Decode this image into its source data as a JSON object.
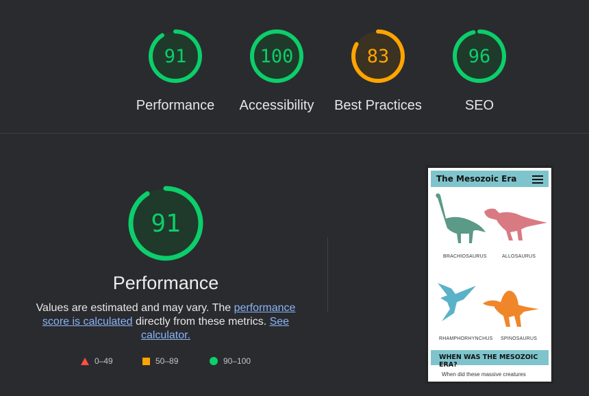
{
  "scores": [
    {
      "label": "Performance",
      "value": "91",
      "fraction": 0.91,
      "color": "#0cce6b",
      "fill": "#1f3a2a"
    },
    {
      "label": "Accessibility",
      "value": "100",
      "fraction": 1.0,
      "color": "#0cce6b",
      "fill": "#1f3a2a"
    },
    {
      "label": "Best Practices",
      "value": "83",
      "fraction": 0.83,
      "color": "#ffa400",
      "fill": "#3b3222"
    },
    {
      "label": "SEO",
      "value": "96",
      "fraction": 0.96,
      "color": "#0cce6b",
      "fill": "#1f3a2a"
    }
  ],
  "performance": {
    "title": "Performance",
    "value": "91",
    "fraction": 0.91,
    "desc_start": "Values are estimated and may vary. The ",
    "desc_link1": "performance score is calculated",
    "desc_middle": " directly from these metrics. ",
    "desc_link2": "See calculator."
  },
  "legend": [
    {
      "label": "0–49",
      "shape": "triangle",
      "color": "#ff4e42"
    },
    {
      "label": "50–89",
      "shape": "square",
      "color": "#ffa400"
    },
    {
      "label": "90–100",
      "shape": "circle",
      "color": "#0cce6b"
    }
  ],
  "screenshot": {
    "title": "The Mesozoic Era",
    "dinos": [
      "BRACHIOSAURUS",
      "ALLOSAURUS",
      "RHAMPHORHYNCHUS",
      "SPINOSAURUS"
    ],
    "heading": "WHEN WAS THE MESOZOIC ERA?",
    "body": "When did these massive creatures"
  }
}
